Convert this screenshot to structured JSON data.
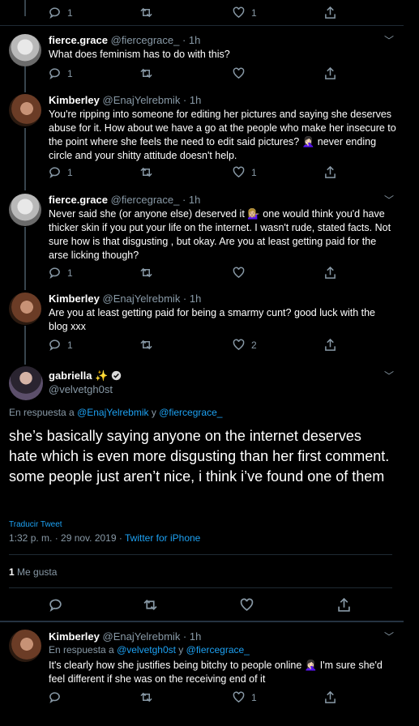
{
  "tweets": [
    {
      "counts": {
        "reply": "1",
        "retweet": "",
        "like": "1"
      }
    },
    {
      "name": "fierce.grace",
      "handle": "@fiercegrace_ · 1h",
      "text": "What does feminism has to do with this?",
      "counts": {
        "reply": "1",
        "retweet": "",
        "like": ""
      }
    },
    {
      "name": "Kimberley",
      "handle": "@EnajYelrebmik · 1h",
      "text": "You're ripping into someone for editing her pictures and saying she deserves abuse for it. How about we have a go at the people who make her insecure to the point where she feels the need to edit said pictures? 🤦🏻‍♀️ never ending circle and your shitty attitude doesn't help.",
      "counts": {
        "reply": "1",
        "retweet": "",
        "like": "1"
      }
    },
    {
      "name": "fierce.grace",
      "handle": "@fiercegrace_ · 1h",
      "text": "Never said she (or anyone else) deserved it 💁🏼‍♀️ one would think you'd have thicker skin if you put your life on the internet. I wasn't rude, stated facts. Not sure how is that disgusting , but okay. Are you at least getting paid for the arse licking though?",
      "counts": {
        "reply": "1",
        "retweet": "",
        "like": ""
      }
    },
    {
      "name": "Kimberley",
      "handle": "@EnajYelrebmik · 1h",
      "text": "Are you at least getting paid for being a smarmy cunt? good luck with the blog xxx",
      "counts": {
        "reply": "1",
        "retweet": "",
        "like": "2"
      }
    }
  ],
  "main": {
    "name": "gabriella ✨",
    "handle": "@velvetgh0st",
    "reply_prefix": "En respuesta a",
    "reply_user1": "@EnajYelrebmik",
    "reply_and": "y",
    "reply_user2": "@fiercegrace_",
    "text": "she’s basically saying anyone on the internet deserves hate which is even more disgusting than her first comment. some people just aren’t nice, i think i’ve found one of them",
    "translate": "Traducir Tweet",
    "timestamp": "1:32 p. m. · 29 nov. 2019 ·",
    "source": "Twitter for iPhone",
    "likes_count": "1",
    "likes_label": "Me gusta"
  },
  "last": {
    "name": "Kimberley",
    "handle": "@EnajYelrebmik · 1h",
    "reply_prefix": "En respuesta a",
    "reply_user1": "@velvetgh0st",
    "reply_and": "y",
    "reply_user2": "@fiercegrace_",
    "text": "It's clearly how she justifies being bitchy to people online 🤦🏻‍♀️ I'm sure she'd feel different if she was on the receiving end of it",
    "counts": {
      "reply": "",
      "retweet": "",
      "like": "1"
    }
  },
  "colors": {
    "background": "#000000",
    "accent": "#1da1f2",
    "muted": "#8899a6"
  }
}
